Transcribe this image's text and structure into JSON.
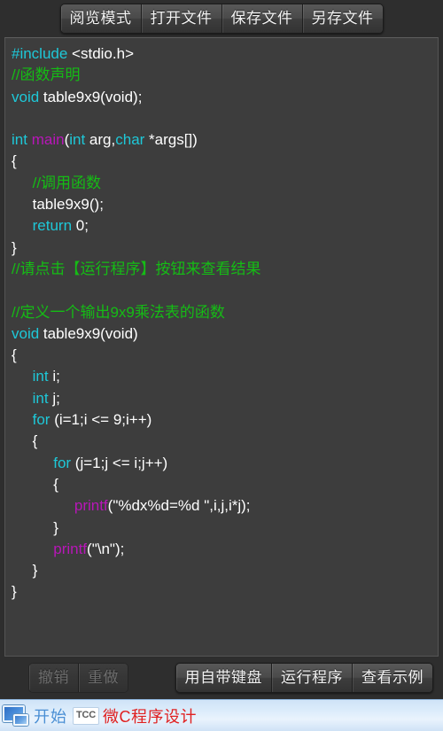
{
  "window": {
    "app_name": "微C程序设计",
    "background": "#2e2e2e"
  },
  "toolbar_top": {
    "buttons": [
      {
        "label": "阅览模式",
        "name": "read-mode-button",
        "disabled": false
      },
      {
        "label": "打开文件",
        "name": "open-file-button",
        "disabled": false
      },
      {
        "label": "保存文件",
        "name": "save-file-button",
        "disabled": false
      },
      {
        "label": "另存文件",
        "name": "save-as-file-button",
        "disabled": false
      }
    ]
  },
  "editor": {
    "language": "c",
    "colors": {
      "background": "#3d3d3d",
      "text": "#ffffff",
      "keyword": "#1ec8d8",
      "function": "#b816b8",
      "comment": "#15bc15"
    },
    "lines": [
      [
        {
          "t": "#include",
          "c": "kw"
        },
        {
          "t": " <stdio.h>",
          "c": "tx"
        }
      ],
      [
        {
          "t": "//函数声明",
          "c": "cm"
        }
      ],
      [
        {
          "t": "void",
          "c": "kw"
        },
        {
          "t": " table9x9(void);",
          "c": "tx"
        }
      ],
      [],
      [
        {
          "t": "int",
          "c": "kw"
        },
        {
          "t": " ",
          "c": "tx"
        },
        {
          "t": "main",
          "c": "fn"
        },
        {
          "t": "(",
          "c": "tx"
        },
        {
          "t": "int",
          "c": "kw"
        },
        {
          "t": " arg,",
          "c": "tx"
        },
        {
          "t": "char",
          "c": "kw"
        },
        {
          "t": " *args[])",
          "c": "tx"
        }
      ],
      [
        {
          "t": "{",
          "c": "tx"
        }
      ],
      [
        {
          "t": "     //调用函数",
          "c": "cm"
        }
      ],
      [
        {
          "t": "     table9x9();",
          "c": "tx"
        }
      ],
      [
        {
          "t": "     ",
          "c": "tx"
        },
        {
          "t": "return",
          "c": "kw"
        },
        {
          "t": " 0;",
          "c": "tx"
        }
      ],
      [
        {
          "t": "}",
          "c": "tx"
        }
      ],
      [
        {
          "t": "//请点击【运行程序】按钮来查看结果",
          "c": "cm"
        }
      ],
      [],
      [
        {
          "t": "//定义一个输出9x9乘法表的函数",
          "c": "cm"
        }
      ],
      [
        {
          "t": "void",
          "c": "kw"
        },
        {
          "t": " table9x9(void)",
          "c": "tx"
        }
      ],
      [
        {
          "t": "{",
          "c": "tx"
        }
      ],
      [
        {
          "t": "     ",
          "c": "tx"
        },
        {
          "t": "int",
          "c": "kw"
        },
        {
          "t": " i;",
          "c": "tx"
        }
      ],
      [
        {
          "t": "     ",
          "c": "tx"
        },
        {
          "t": "int",
          "c": "kw"
        },
        {
          "t": " j;",
          "c": "tx"
        }
      ],
      [
        {
          "t": "     ",
          "c": "tx"
        },
        {
          "t": "for",
          "c": "kw"
        },
        {
          "t": " (i=1;i <= 9;i++)",
          "c": "tx"
        }
      ],
      [
        {
          "t": "     {",
          "c": "tx"
        }
      ],
      [
        {
          "t": "          ",
          "c": "tx"
        },
        {
          "t": "for",
          "c": "kw"
        },
        {
          "t": " (j=1;j <= i;j++)",
          "c": "tx"
        }
      ],
      [
        {
          "t": "          {",
          "c": "tx"
        }
      ],
      [
        {
          "t": "               ",
          "c": "tx"
        },
        {
          "t": "printf",
          "c": "fn"
        },
        {
          "t": "(\"%dx%d=%d \",i,j,i*j);",
          "c": "tx"
        }
      ],
      [
        {
          "t": "          }",
          "c": "tx"
        }
      ],
      [
        {
          "t": "          ",
          "c": "tx"
        },
        {
          "t": "printf",
          "c": "fn"
        },
        {
          "t": "(\"\\n\");",
          "c": "tx"
        }
      ],
      [
        {
          "t": "     }",
          "c": "tx"
        }
      ],
      [
        {
          "t": "}",
          "c": "tx"
        }
      ]
    ]
  },
  "toolbar_bottom": {
    "left_buttons": [
      {
        "label": "撤销",
        "name": "undo-button",
        "disabled": true
      },
      {
        "label": "重做",
        "name": "redo-button",
        "disabled": true
      }
    ],
    "right_buttons": [
      {
        "label": "用自带键盘",
        "name": "builtin-keyboard-button",
        "disabled": false
      },
      {
        "label": "运行程序",
        "name": "run-program-button",
        "disabled": false
      },
      {
        "label": "查看示例",
        "name": "view-example-button",
        "disabled": false
      }
    ]
  },
  "taskbar": {
    "start_label": "开始",
    "app_icon_label": "TCC",
    "app_label": "微C程序设计",
    "start_color": "#4a8fd4",
    "app_color": "#e02121"
  }
}
